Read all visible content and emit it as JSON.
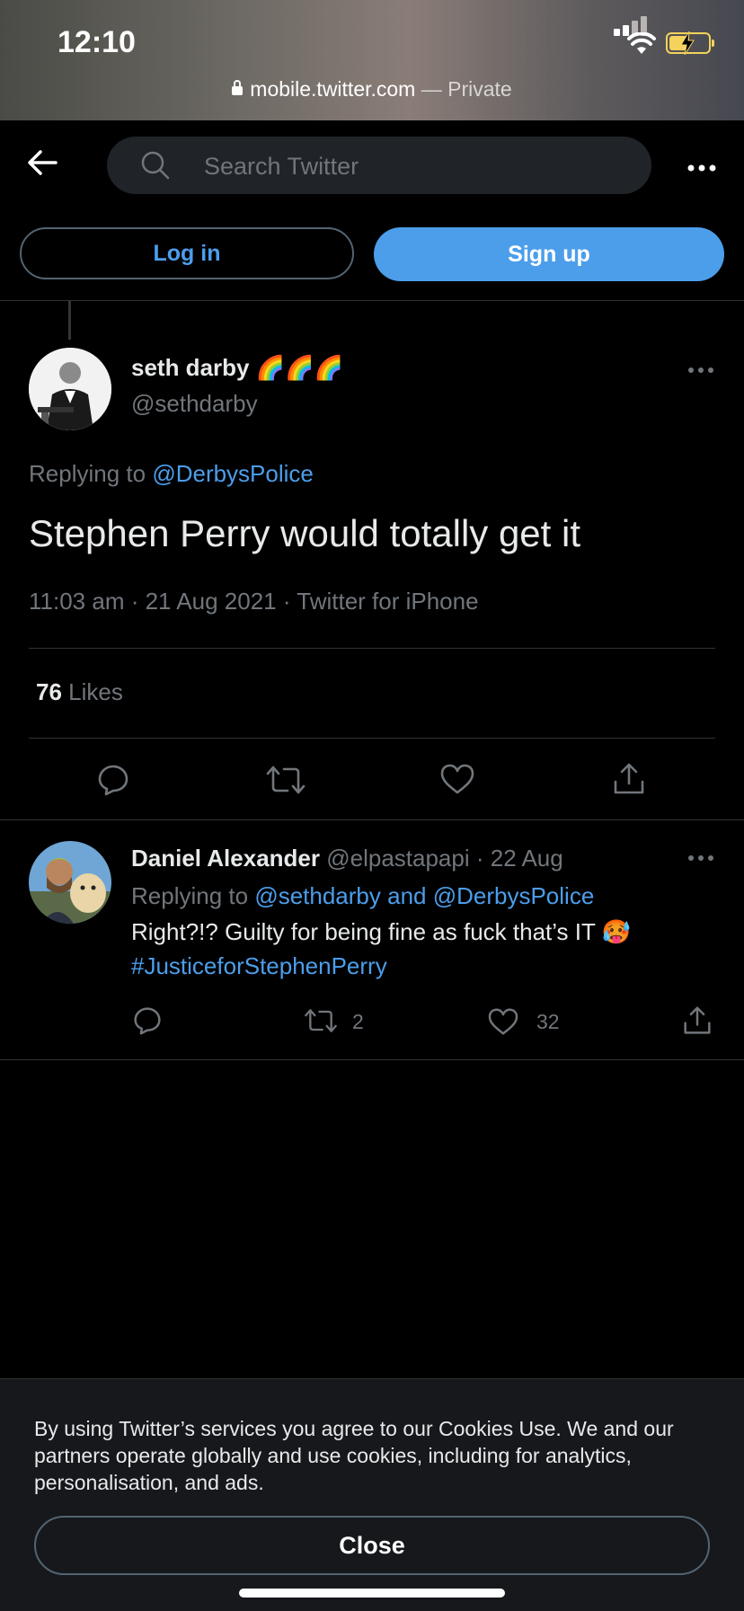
{
  "status_bar": {
    "time": "12:10",
    "url": "mobile.twitter.com",
    "url_suffix": " — Private"
  },
  "header": {
    "search_placeholder": "Search Twitter",
    "login_label": "Log in",
    "signup_label": "Sign up"
  },
  "main_tweet": {
    "display_name": "seth darby",
    "name_emojis": "🌈🌈🌈",
    "handle": "@sethdarby",
    "replying_prefix": "Replying to ",
    "replying_to": "@DerbysPolice",
    "text": "Stephen Perry would totally get it",
    "meta": "11:03 am · 21 Aug 2021 · Twitter for iPhone",
    "likes_count": "76",
    "likes_label": " Likes"
  },
  "reply_tweet": {
    "display_name": "Daniel Alexander",
    "handle_date": " @elpastapapi · 22 Aug",
    "replying_prefix": "Replying to ",
    "replying_to": "@sethdarby and @DerbysPolice",
    "text": "Right?!? Guilty for being fine as fuck that’s IT ",
    "emoji": "🥵",
    "hashtag": "#JusticeforStephenPerry",
    "retweets": "2",
    "likes": "32"
  },
  "cookie_banner": {
    "text": "By using Twitter’s services you agree to our Cookies Use. We and our partners operate globally and use cookies, including for analytics, personalisation, and ads.",
    "close_label": "Close"
  },
  "colors": {
    "accent": "#4c9eeb",
    "background": "#000000",
    "muted": "#71767b"
  }
}
